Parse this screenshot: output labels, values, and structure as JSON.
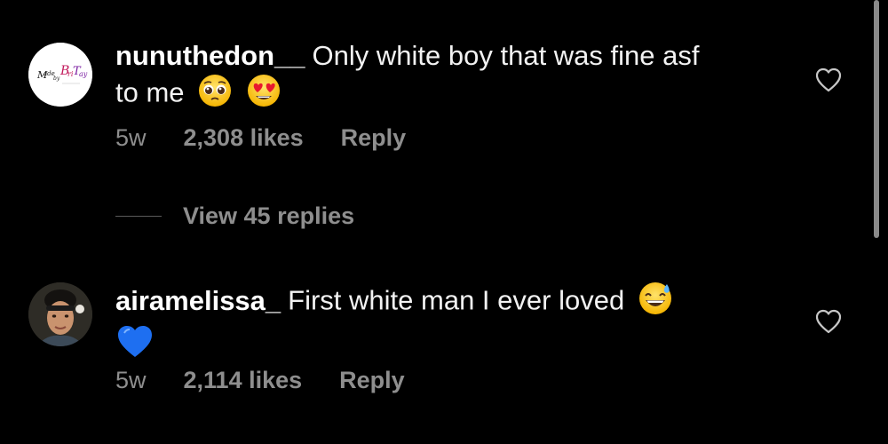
{
  "comments": [
    {
      "username": "nunuthedon__",
      "text": "Only white boy that was fine asf to me",
      "emojis": [
        "pleading-face-emoji",
        "heart-eyes-emoji"
      ],
      "age": "5w",
      "likes": "2,308 likes",
      "reply": "Reply",
      "avatar_logo_text": "Made by Bri Tay"
    },
    {
      "username": "airamelissa_",
      "text": "First white man I ever loved",
      "emojis": [
        "grinning-sweat-emoji",
        "blue-heart-emoji"
      ],
      "age": "5w",
      "likes": "2,114 likes",
      "reply": "Reply"
    }
  ],
  "view_replies": "View 45 replies",
  "colors": {
    "background": "#000000",
    "text": "#f2f2f2",
    "muted": "#8e8e8e",
    "scrollbar": "#8a8a8a"
  }
}
